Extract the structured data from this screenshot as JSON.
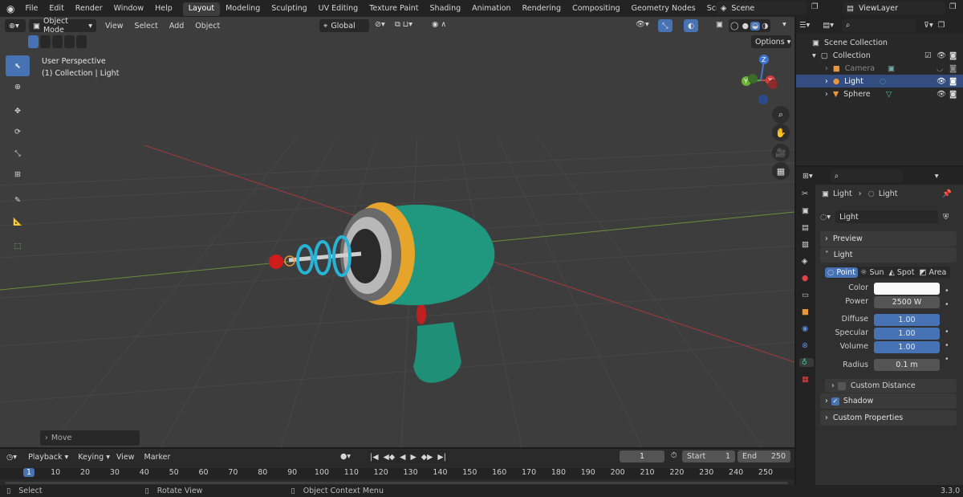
{
  "topbar": {
    "menu": [
      "File",
      "Edit",
      "Render",
      "Window",
      "Help"
    ],
    "workspaces": [
      "Layout",
      "Modeling",
      "Sculpting",
      "UV Editing",
      "Texture Paint",
      "Shading",
      "Animation",
      "Rendering",
      "Compositing",
      "Geometry Nodes",
      "Scripting"
    ],
    "add_tab": "+",
    "scene": "Scene",
    "view_layer": "ViewLayer"
  },
  "viewport": {
    "mode": "Object Mode",
    "menu": [
      "View",
      "Select",
      "Add",
      "Object"
    ],
    "orientation": "Global",
    "options": "Options",
    "overlay_line1": "User Perspective",
    "overlay_line2": "(1) Collection | Light",
    "last_op": "Move",
    "gizmo_axes": [
      "X",
      "Y",
      "Z"
    ]
  },
  "outliner": {
    "root": "Scene Collection",
    "collection": "Collection",
    "items": [
      {
        "label": "Camera",
        "type": "camera"
      },
      {
        "label": "Light",
        "type": "light",
        "selected": true
      },
      {
        "label": "Sphere",
        "type": "mesh"
      }
    ]
  },
  "properties": {
    "breadcrumb": [
      "Light",
      "Light"
    ],
    "data_name": "Light",
    "sections": {
      "preview": "Preview",
      "light": "Light",
      "custom_distance": "Custom Distance",
      "shadow": "Shadow",
      "custom_props": "Custom Properties"
    },
    "types": [
      "Point",
      "Sun",
      "Spot",
      "Area"
    ],
    "active_type": "Point",
    "fields": [
      {
        "label": "Color",
        "value": "",
        "kind": "color"
      },
      {
        "label": "Power",
        "value": "2500 W",
        "kind": "num"
      },
      {
        "label": "Diffuse",
        "value": "1.00",
        "kind": "slider"
      },
      {
        "label": "Specular",
        "value": "1.00",
        "kind": "slider"
      },
      {
        "label": "Volume",
        "value": "1.00",
        "kind": "slider"
      },
      {
        "label": "Radius",
        "value": "0.1 m",
        "kind": "num"
      }
    ],
    "shadow_checked": true,
    "custom_distance_checked": false
  },
  "timeline": {
    "menu": [
      "Playback",
      "Keying",
      "View",
      "Marker"
    ],
    "current_frame": "1",
    "start_label": "Start",
    "start": "1",
    "end_label": "End",
    "end": "250",
    "ruler": [
      "1",
      "10",
      "20",
      "30",
      "40",
      "50",
      "60",
      "70",
      "80",
      "90",
      "100",
      "110",
      "120",
      "130",
      "140",
      "150",
      "160",
      "170",
      "180",
      "190",
      "200",
      "210",
      "220",
      "230",
      "240",
      "250"
    ]
  },
  "status": {
    "select": "Select",
    "rotate": "Rotate View",
    "context": "Object Context Menu",
    "version": "3.3.0"
  },
  "colors": {
    "accent": "#4772b3",
    "orange": "#e8973a",
    "viewport_bg": "#3d3d3d"
  }
}
